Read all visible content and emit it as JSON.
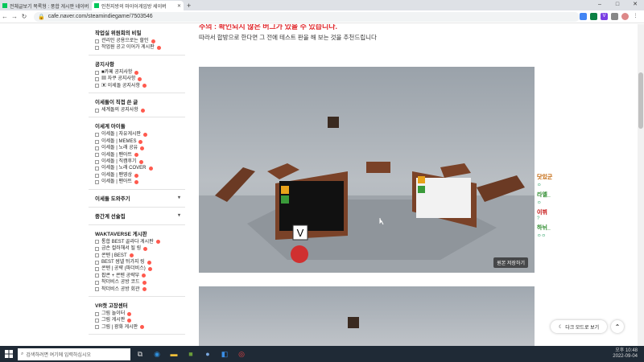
{
  "browser": {
    "tabs": [
      {
        "label": "전체글보기 목록형 : 풍합 게시판 네이버"
      },
      {
        "label": "인천지방의 마이어게임방 세이버"
      }
    ],
    "url": "cafe.naver.com/steamindiegame/7503546",
    "window_controls": [
      "–",
      "□",
      "✕"
    ]
  },
  "sidebar": {
    "sections": [
      {
        "title": "작업실 위원회의 비밀",
        "items": [
          {
            "label": "관리인 공용으로는 할인"
          },
          {
            "label": "작업원 공고 이어가 게시판"
          }
        ]
      },
      {
        "title": "공지사항",
        "items": [
          {
            "label": "■카페 공지사항"
          },
          {
            "label": "▦ 자쿠 공지사항"
          },
          {
            "label": "▣ 이세돌 공지사항"
          }
        ]
      },
      {
        "title": "이세돌이 직접 쓴 글",
        "items": [
          {
            "label": "세계돌의 공지사항"
          }
        ]
      },
      {
        "title": "이세계 아이돌",
        "items": [
          {
            "label": "이세돌 | 자유게시판"
          },
          {
            "label": "이세돌 | MEMES"
          },
          {
            "label": "이세돌 | 노래 공유"
          },
          {
            "label": "이세돌 | 팬아트"
          },
          {
            "label": "이세돌 | 직캠후기"
          },
          {
            "label": "이세돌 | 노래 COVER"
          },
          {
            "label": "이세돌 | 팬영상"
          },
          {
            "label": "이세돌 | 팬아트"
          }
        ]
      },
      {
        "title": "이세돌 도와주기",
        "items": []
      },
      {
        "title": "중간계 선술집",
        "items": []
      },
      {
        "title": "WAKTAVERSE 게시판",
        "items": [
          {
            "label": "통합 BEST 골라다 게시판"
          },
          {
            "label": "금손 컬러해서 될 링"
          },
          {
            "label": "콘텐 | BEST"
          },
          {
            "label": "BEST 썸넬 뒤가지 링"
          },
          {
            "label": "콘텐 | 공략 (파더비스)"
          },
          {
            "label": "팝콘 + 콘텐 공략부"
          },
          {
            "label": "착더비스 공방 코드"
          },
          {
            "label": "착더비스 공방 회관"
          }
        ]
      },
      {
        "title": "VR캣 고장센터",
        "items": [
          {
            "label": "그림 놀이터"
          },
          {
            "label": "그림 게시판"
          },
          {
            "label": "그림 | 광화 게시판"
          }
        ]
      }
    ]
  },
  "article": {
    "warning": "주의 : 확인되지 않은 버그가 있을 수 있습니다.",
    "description": "따라서 합방으로 한다면 그 전에 테스트 판을 해 보는 것을 추천드립니다",
    "image_button": "원본 저장하기",
    "game_v_label": "V"
  },
  "chat": [
    {
      "user": "닷있군",
      "msg": "ㅇ",
      "color": "#c06000"
    },
    {
      "user": "라엘_",
      "msg": "ㅇ",
      "color": "#2a8a2a"
    },
    {
      "user": "이뷔",
      "msg": "?",
      "color": "#c00000"
    },
    {
      "user": "하뉘_",
      "msg": "ㅇㅇ",
      "color": "#2a8a2a"
    }
  ],
  "floating": {
    "dark_mode": "다크 모드로 보기",
    "top": "⌃"
  },
  "taskbar": {
    "search_placeholder": "검색하려면 여기에 입력하십시오",
    "time": "오후 10:48",
    "date": "2022-09-04"
  },
  "colors": {
    "accent": "#03c75a",
    "warning": "#e0282c",
    "new_badge": "#ff5a4e"
  }
}
